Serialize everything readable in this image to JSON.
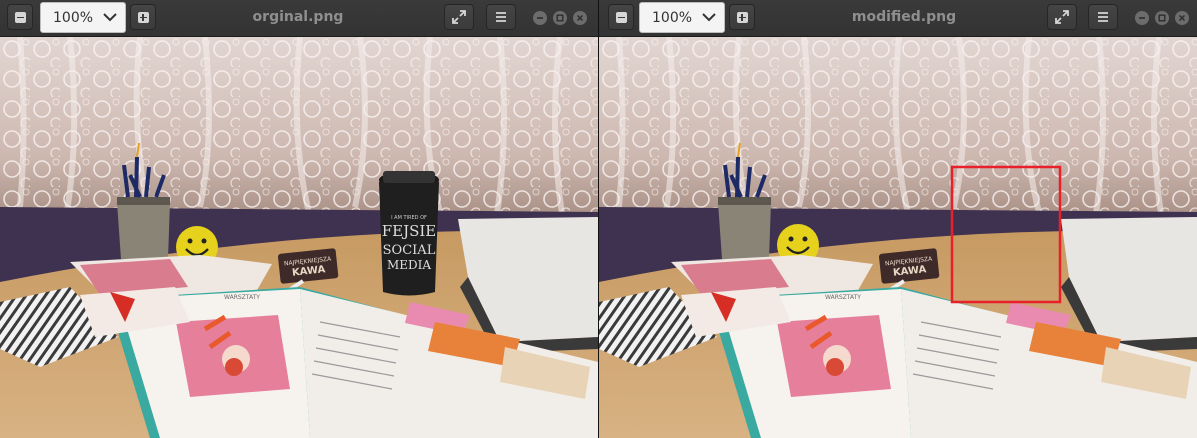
{
  "left": {
    "zoom_value": "100%",
    "filename": "orginal.png"
  },
  "right": {
    "zoom_value": "100%",
    "filename": "modified.png"
  },
  "photo": {
    "coaster_line1": "NAJPIĘKNIEJSZA",
    "coaster_line2": "KAWA",
    "cup_line1": "I AM TIRED OF",
    "cup_line2": "FEJSIE",
    "cup_line3": "SOCIAL",
    "cup_line4": "MEDIA",
    "book_header": "WARSZTATY"
  },
  "colors": {
    "highlight": "#e8202a",
    "titlebar": "#363636"
  }
}
